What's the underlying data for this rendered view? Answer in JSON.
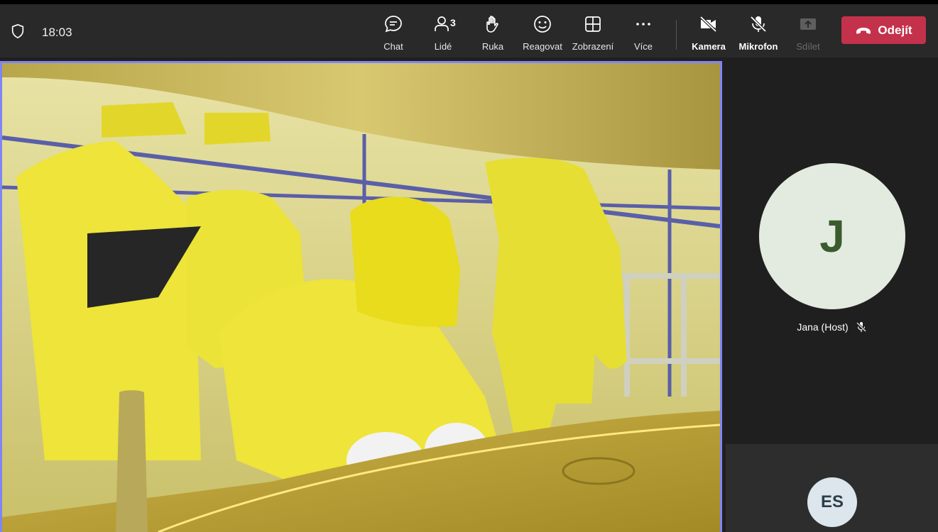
{
  "header": {
    "time": "18:03",
    "buttons": {
      "chat": "Chat",
      "people": "Lidé",
      "people_count": "3",
      "raise_hand": "Ruka",
      "react": "Reagovat",
      "view": "Zobrazení",
      "more": "Více",
      "camera": "Kamera",
      "mic": "Mikrofon",
      "share": "Sdílet"
    },
    "leave_label": "Odejít"
  },
  "colors": {
    "leave_button": "#c4314b",
    "active_speaker_border": "#7f85f5",
    "toolbar_bg": "#292929"
  },
  "participants": [
    {
      "initials": "J",
      "name": "Jana (Host)",
      "muted": true
    },
    {
      "initials": "ES"
    }
  ]
}
